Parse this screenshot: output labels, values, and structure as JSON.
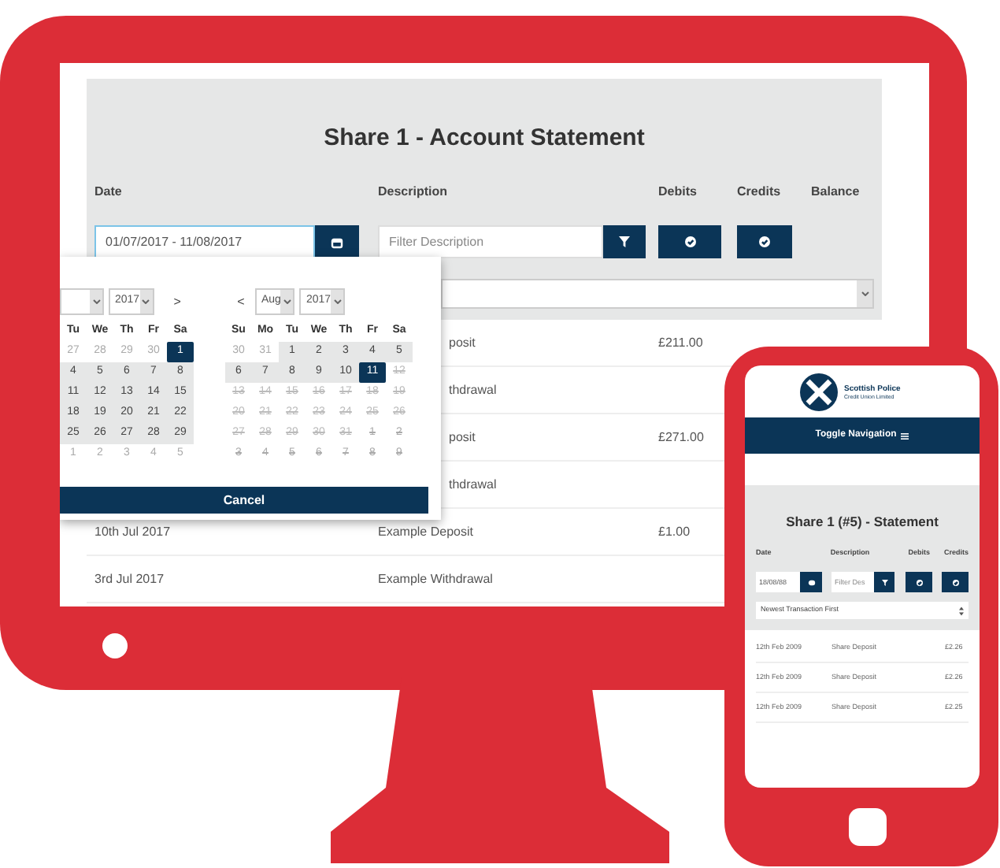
{
  "desktop": {
    "title": "Share 1 - Account Statement",
    "columns": [
      "Date",
      "Description",
      "Debits",
      "Credits",
      "Balance"
    ],
    "date_range": {
      "value": "01/07/2017 - 11/08/2017"
    },
    "filter": {
      "placeholder": "Filter Description"
    },
    "date_picker": {
      "calendars": [
        {
          "year": "2017",
          "next": ">",
          "headers": [
            "Tu",
            "We",
            "Th",
            "Fr",
            "Sa"
          ],
          "weeks": [
            [
              {
                "day": "27",
                "selected": false,
                "in_range": false,
                "muted": true,
                "disabled": false
              },
              {
                "day": "28",
                "selected": false,
                "in_range": false,
                "muted": true,
                "disabled": false
              },
              {
                "day": "29",
                "selected": false,
                "in_range": false,
                "muted": true,
                "disabled": false
              },
              {
                "day": "30",
                "selected": false,
                "in_range": false,
                "muted": true,
                "disabled": false
              },
              {
                "day": "1",
                "selected": true,
                "in_range": false,
                "muted": false,
                "disabled": false
              }
            ],
            [
              {
                "day": "4",
                "selected": false,
                "in_range": true,
                "muted": false,
                "disabled": false
              },
              {
                "day": "5",
                "selected": false,
                "in_range": true,
                "muted": false,
                "disabled": false
              },
              {
                "day": "6",
                "selected": false,
                "in_range": true,
                "muted": false,
                "disabled": false
              },
              {
                "day": "7",
                "selected": false,
                "in_range": true,
                "muted": false,
                "disabled": false
              },
              {
                "day": "8",
                "selected": false,
                "in_range": true,
                "muted": false,
                "disabled": false
              }
            ],
            [
              {
                "day": "11",
                "selected": false,
                "in_range": true,
                "muted": false,
                "disabled": false
              },
              {
                "day": "12",
                "selected": false,
                "in_range": true,
                "muted": false,
                "disabled": false
              },
              {
                "day": "13",
                "selected": false,
                "in_range": true,
                "muted": false,
                "disabled": false
              },
              {
                "day": "14",
                "selected": false,
                "in_range": true,
                "muted": false,
                "disabled": false
              },
              {
                "day": "15",
                "selected": false,
                "in_range": true,
                "muted": false,
                "disabled": false
              }
            ],
            [
              {
                "day": "18",
                "selected": false,
                "in_range": true,
                "muted": false,
                "disabled": false
              },
              {
                "day": "19",
                "selected": false,
                "in_range": true,
                "muted": false,
                "disabled": false
              },
              {
                "day": "20",
                "selected": false,
                "in_range": true,
                "muted": false,
                "disabled": false
              },
              {
                "day": "21",
                "selected": false,
                "in_range": true,
                "muted": false,
                "disabled": false
              },
              {
                "day": "22",
                "selected": false,
                "in_range": true,
                "muted": false,
                "disabled": false
              }
            ],
            [
              {
                "day": "25",
                "selected": false,
                "in_range": true,
                "muted": false,
                "disabled": false
              },
              {
                "day": "26",
                "selected": false,
                "in_range": true,
                "muted": false,
                "disabled": false
              },
              {
                "day": "27",
                "selected": false,
                "in_range": true,
                "muted": false,
                "disabled": false
              },
              {
                "day": "28",
                "selected": false,
                "in_range": true,
                "muted": false,
                "disabled": false
              },
              {
                "day": "29",
                "selected": false,
                "in_range": true,
                "muted": false,
                "disabled": false
              }
            ],
            [
              {
                "day": "1",
                "selected": false,
                "in_range": false,
                "muted": true,
                "disabled": false
              },
              {
                "day": "2",
                "selected": false,
                "in_range": false,
                "muted": true,
                "disabled": false
              },
              {
                "day": "3",
                "selected": false,
                "in_range": false,
                "muted": true,
                "disabled": false
              },
              {
                "day": "4",
                "selected": false,
                "in_range": false,
                "muted": true,
                "disabled": false
              },
              {
                "day": "5",
                "selected": false,
                "in_range": false,
                "muted": true,
                "disabled": false
              }
            ]
          ]
        },
        {
          "prev": "<",
          "month": "Aug",
          "year": "2017",
          "headers": [
            "Su",
            "Mo",
            "Tu",
            "We",
            "Th",
            "Fr",
            "Sa"
          ],
          "weeks": [
            [
              {
                "day": "30",
                "selected": false,
                "in_range": false,
                "muted": true,
                "disabled": false
              },
              {
                "day": "31",
                "selected": false,
                "in_range": false,
                "muted": true,
                "disabled": false
              },
              {
                "day": "1",
                "selected": false,
                "in_range": true,
                "muted": false,
                "disabled": false
              },
              {
                "day": "2",
                "selected": false,
                "in_range": true,
                "muted": false,
                "disabled": false
              },
              {
                "day": "3",
                "selected": false,
                "in_range": true,
                "muted": false,
                "disabled": false
              },
              {
                "day": "4",
                "selected": false,
                "in_range": true,
                "muted": false,
                "disabled": false
              },
              {
                "day": "5",
                "selected": false,
                "in_range": true,
                "muted": false,
                "disabled": false
              }
            ],
            [
              {
                "day": "6",
                "selected": false,
                "in_range": true,
                "muted": false,
                "disabled": false
              },
              {
                "day": "7",
                "selected": false,
                "in_range": true,
                "muted": false,
                "disabled": false
              },
              {
                "day": "8",
                "selected": false,
                "in_range": true,
                "muted": false,
                "disabled": false
              },
              {
                "day": "9",
                "selected": false,
                "in_range": true,
                "muted": false,
                "disabled": false
              },
              {
                "day": "10",
                "selected": false,
                "in_range": true,
                "muted": false,
                "disabled": false
              },
              {
                "day": "11",
                "selected": true,
                "in_range": false,
                "muted": false,
                "disabled": false
              },
              {
                "day": "12",
                "selected": false,
                "in_range": false,
                "muted": false,
                "disabled": true
              }
            ],
            [
              {
                "day": "13",
                "selected": false,
                "in_range": false,
                "muted": false,
                "disabled": true
              },
              {
                "day": "14",
                "selected": false,
                "in_range": false,
                "muted": false,
                "disabled": true
              },
              {
                "day": "15",
                "selected": false,
                "in_range": false,
                "muted": false,
                "disabled": true
              },
              {
                "day": "16",
                "selected": false,
                "in_range": false,
                "muted": false,
                "disabled": true
              },
              {
                "day": "17",
                "selected": false,
                "in_range": false,
                "muted": false,
                "disabled": true
              },
              {
                "day": "18",
                "selected": false,
                "in_range": false,
                "muted": false,
                "disabled": true
              },
              {
                "day": "19",
                "selected": false,
                "in_range": false,
                "muted": false,
                "disabled": true
              }
            ],
            [
              {
                "day": "20",
                "selected": false,
                "in_range": false,
                "muted": false,
                "disabled": true
              },
              {
                "day": "21",
                "selected": false,
                "in_range": false,
                "muted": false,
                "disabled": true
              },
              {
                "day": "22",
                "selected": false,
                "in_range": false,
                "muted": false,
                "disabled": true
              },
              {
                "day": "23",
                "selected": false,
                "in_range": false,
                "muted": false,
                "disabled": true
              },
              {
                "day": "24",
                "selected": false,
                "in_range": false,
                "muted": false,
                "disabled": true
              },
              {
                "day": "25",
                "selected": false,
                "in_range": false,
                "muted": false,
                "disabled": true
              },
              {
                "day": "26",
                "selected": false,
                "in_range": false,
                "muted": false,
                "disabled": true
              }
            ],
            [
              {
                "day": "27",
                "selected": false,
                "in_range": false,
                "muted": false,
                "disabled": true
              },
              {
                "day": "28",
                "selected": false,
                "in_range": false,
                "muted": false,
                "disabled": true
              },
              {
                "day": "29",
                "selected": false,
                "in_range": false,
                "muted": false,
                "disabled": true
              },
              {
                "day": "30",
                "selected": false,
                "in_range": false,
                "muted": false,
                "disabled": true
              },
              {
                "day": "31",
                "selected": false,
                "in_range": false,
                "muted": false,
                "disabled": true
              },
              {
                "day": "1",
                "selected": false,
                "in_range": false,
                "muted": true,
                "disabled": true
              },
              {
                "day": "2",
                "selected": false,
                "in_range": false,
                "muted": true,
                "disabled": true
              }
            ],
            [
              {
                "day": "3",
                "selected": false,
                "in_range": false,
                "muted": true,
                "disabled": true
              },
              {
                "day": "4",
                "selected": false,
                "in_range": false,
                "muted": true,
                "disabled": true
              },
              {
                "day": "5",
                "selected": false,
                "in_range": false,
                "muted": true,
                "disabled": true
              },
              {
                "day": "6",
                "selected": false,
                "in_range": false,
                "muted": true,
                "disabled": true
              },
              {
                "day": "7",
                "selected": false,
                "in_range": false,
                "muted": true,
                "disabled": true
              },
              {
                "day": "8",
                "selected": false,
                "in_range": false,
                "muted": true,
                "disabled": true
              },
              {
                "day": "9",
                "selected": false,
                "in_range": false,
                "muted": true,
                "disabled": true
              }
            ]
          ]
        }
      ],
      "cancel": "Cancel"
    },
    "rows": [
      {
        "description": "posit",
        "debit": "£211.00"
      },
      {
        "description": "thdrawal"
      },
      {
        "description": "posit",
        "debit": "£271.00"
      },
      {
        "description": "thdrawal"
      },
      {
        "date": "10th Jul 2017",
        "description": "Example Deposit",
        "debit": "£1.00"
      },
      {
        "date": "3rd Jul 2017",
        "description": "Example Withdrawal"
      }
    ]
  },
  "phone": {
    "brand": "Scottish Police",
    "brand_sub": "Credit Union Limited",
    "nav": "Toggle Navigation",
    "title": "Share 1 (#5) - Statement",
    "columns": [
      "Date",
      "Description",
      "Debits",
      "Credits"
    ],
    "date": {
      "value": "18/08/88"
    },
    "filter": {
      "placeholder": "Filter Des"
    },
    "sort": "Newest Transaction First",
    "rows": [
      {
        "date": "12th Feb 2009",
        "description": "Share Deposit",
        "amount": "£2.26"
      },
      {
        "date": "12th Feb 2009",
        "description": "Share Deposit",
        "amount": "£2.26"
      },
      {
        "date": "12th Feb 2009",
        "description": "Share Deposit",
        "amount": "£2.25"
      }
    ]
  }
}
